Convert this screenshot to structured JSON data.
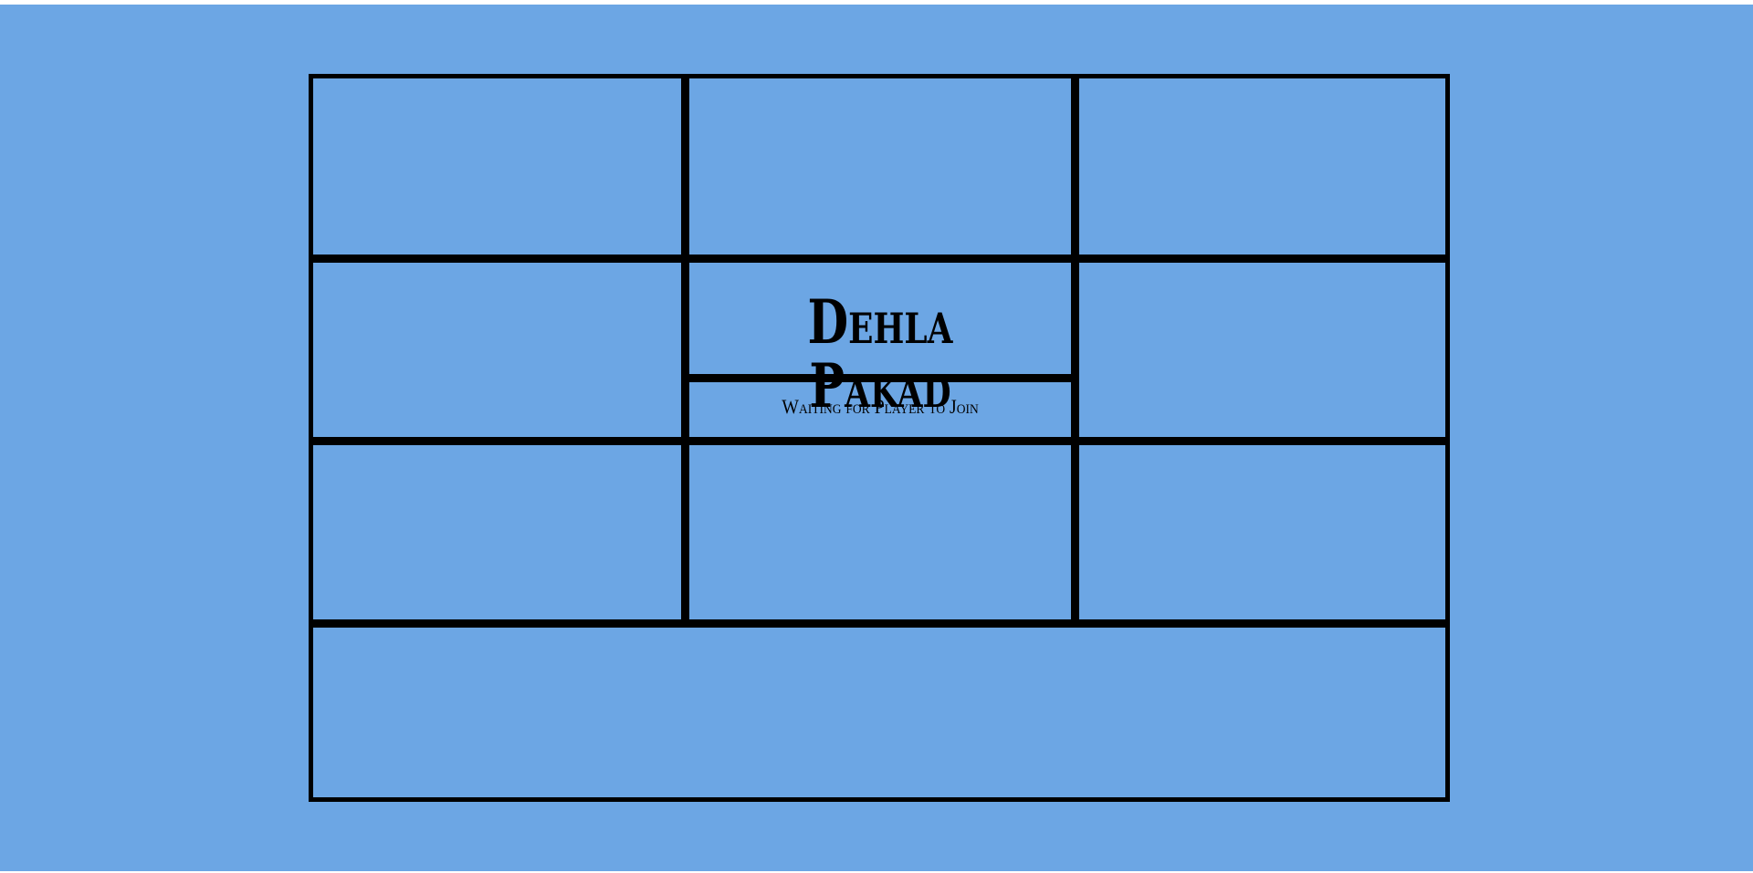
{
  "game": {
    "title": "Dehla Pakad",
    "status": "Waiting for Player to Join"
  },
  "colors": {
    "table_background": "#6ca6e4",
    "grid_lines": "#000000"
  }
}
